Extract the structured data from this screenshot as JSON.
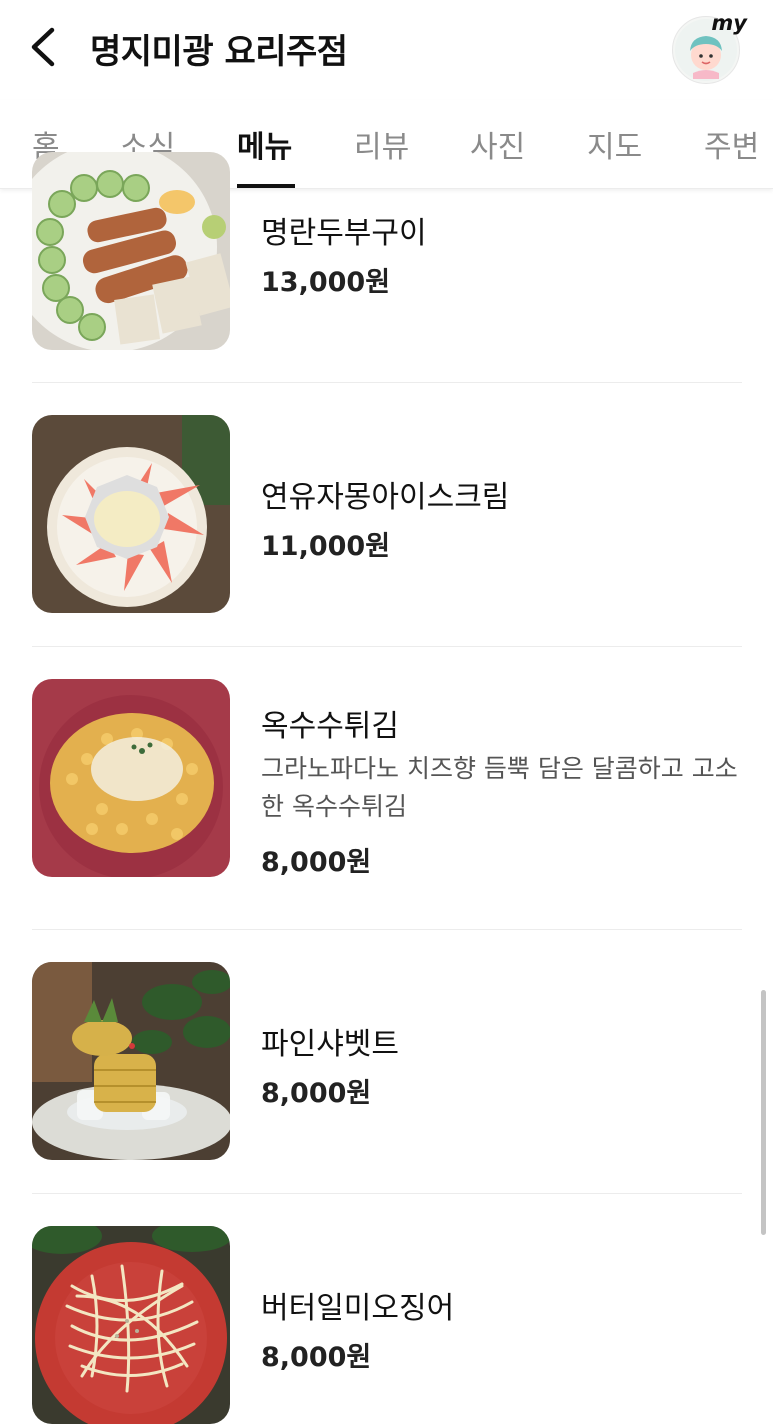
{
  "header": {
    "title": "명지미광 요리주점",
    "back_icon": "chevron-left-icon",
    "avatar_badge": "my"
  },
  "tabs": [
    {
      "label": "홈",
      "active": false
    },
    {
      "label": "소식",
      "active": false
    },
    {
      "label": "메뉴",
      "active": true
    },
    {
      "label": "리뷰",
      "active": false
    },
    {
      "label": "사진",
      "active": false
    },
    {
      "label": "지도",
      "active": false
    },
    {
      "label": "주변",
      "active": false
    }
  ],
  "menu": {
    "items": [
      {
        "name": "명란두부구이",
        "description": "",
        "price": "13,000원"
      },
      {
        "name": "연유자몽아이스크림",
        "description": "",
        "price": "11,000원"
      },
      {
        "name": "옥수수튀김",
        "description": "그라노파다노 치즈향 듬뿍 담은 달콤하고 고소한 옥수수튀김",
        "price": "8,000원"
      },
      {
        "name": "파인샤벳트",
        "description": "",
        "price": "8,000원"
      },
      {
        "name": "버터일미오징어",
        "description": "",
        "price": "8,000원"
      }
    ]
  },
  "colors": {
    "text_primary": "#111111",
    "tab_inactive": "#8a8a8a",
    "divider": "#ececec",
    "scrollbar": "#c4c4c4"
  }
}
